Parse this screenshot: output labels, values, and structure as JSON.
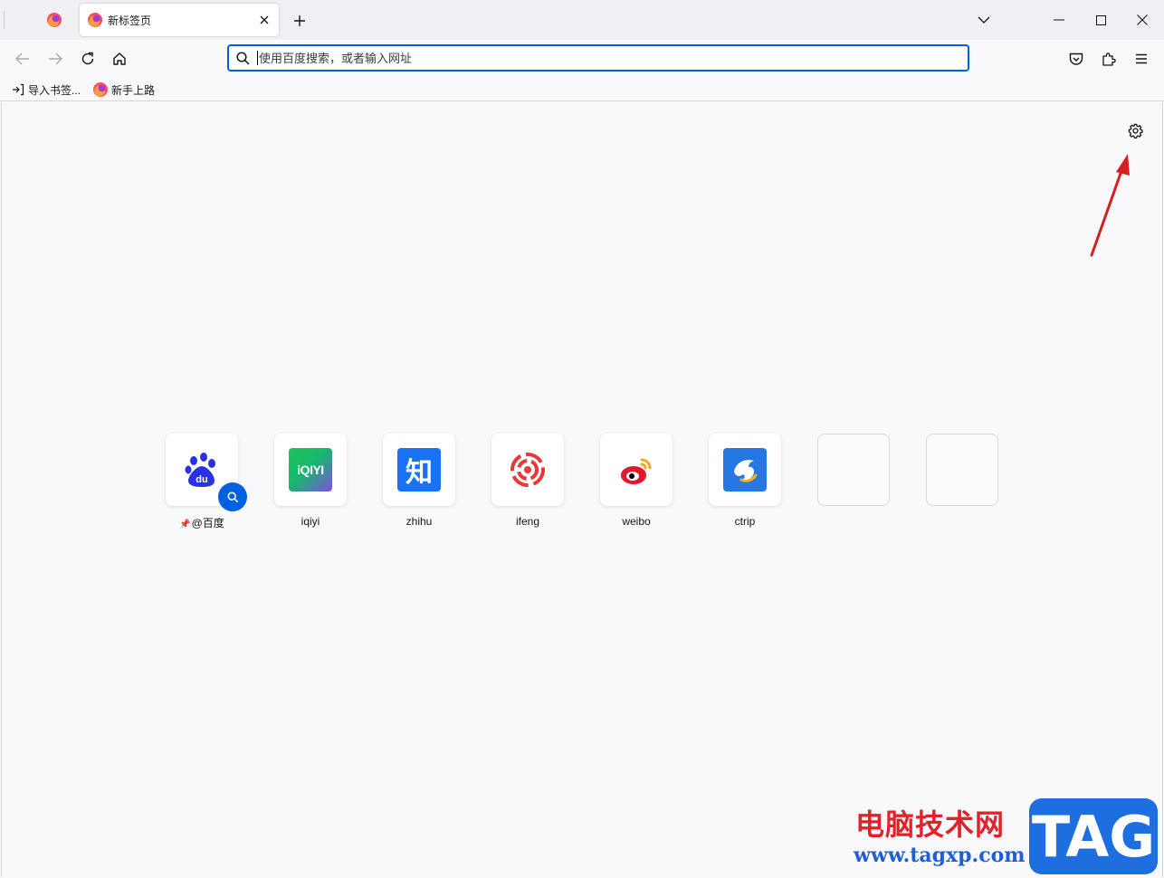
{
  "tabs": {
    "active_title": "新标签页"
  },
  "navbar": {
    "url_placeholder": "使用百度搜索，或者输入网址"
  },
  "bookmarks": [
    {
      "label": "导入书签..."
    },
    {
      "label": "新手上路"
    }
  ],
  "tiles": [
    {
      "label": "@百度",
      "pinned": true
    },
    {
      "label": "iqiyi",
      "icon_text": "iQIYI"
    },
    {
      "label": "zhihu",
      "icon_text": "知"
    },
    {
      "label": "ifeng"
    },
    {
      "label": "weibo"
    },
    {
      "label": "ctrip"
    },
    {
      "label": ""
    },
    {
      "label": ""
    }
  ],
  "watermark": {
    "line1": "电脑技术网",
    "line2": "www.tagxp.com",
    "logo": "TAG"
  },
  "colors": {
    "accent": "#0061e0",
    "annotation_arrow": "#d81e1e"
  }
}
